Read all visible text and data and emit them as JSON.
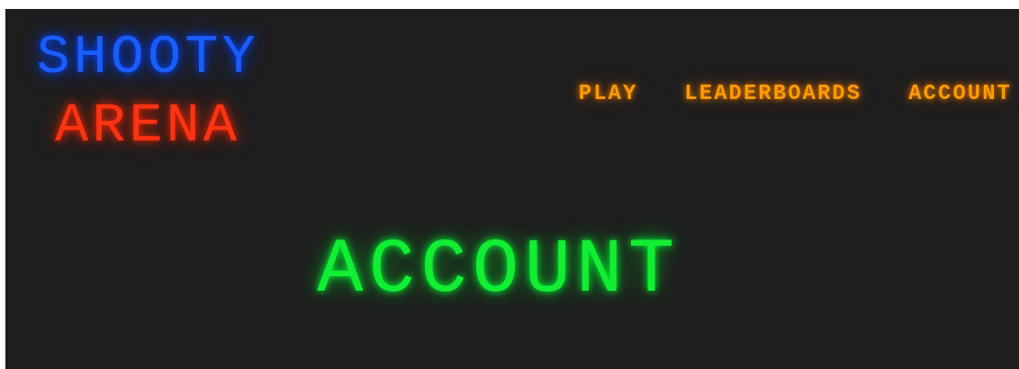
{
  "logo": {
    "line_1": "SHOOTY",
    "line_2": "ARENA"
  },
  "nav": [
    {
      "label": "PLAY"
    },
    {
      "label": "LEADERBOARDS"
    },
    {
      "label": "ACCOUNT"
    }
  ],
  "heading": "ACCOUNT"
}
